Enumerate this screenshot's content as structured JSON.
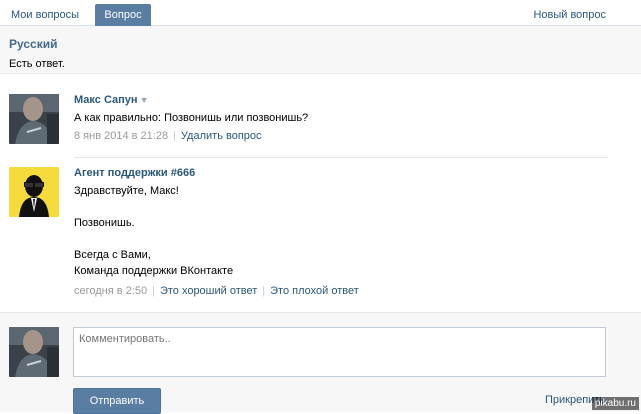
{
  "tabs": [
    {
      "label": "Мои вопросы"
    },
    {
      "label": "Вопрос",
      "active": true
    }
  ],
  "new_question_label": "Новый вопрос",
  "topic": {
    "title": "Русский",
    "status": "Есть ответ."
  },
  "question": {
    "author": "Макс Сапун",
    "text": "А как правильно: Позвонишь или позвонишь?",
    "date": "8 янв 2014 в 21:28",
    "delete_label": "Удалить вопрос",
    "avatar_icon": "user-photo-icon"
  },
  "answer": {
    "author": "Агент поддержки #666",
    "lines": [
      "Здравствуйте, Макс!",
      "",
      "Позвонишь.",
      "",
      "Всегда с Вами,",
      "Команда поддержки ВКонтакте"
    ],
    "date": "сегодня в 2:50",
    "good_label": "Это хороший ответ",
    "bad_label": "Это плохой ответ",
    "avatar_icon": "support-agent-icon"
  },
  "comment": {
    "placeholder": "Комментировать..",
    "send_label": "Отправить",
    "attach_label": "Прикрепить"
  },
  "watermark": "pikabu.ru",
  "colors": {
    "tab_active_bg": "#597da3",
    "link": "#2b587a",
    "author": "#2b587a",
    "button_bg": "#597da3",
    "agent_avatar_bg": "#f5dc3c"
  }
}
